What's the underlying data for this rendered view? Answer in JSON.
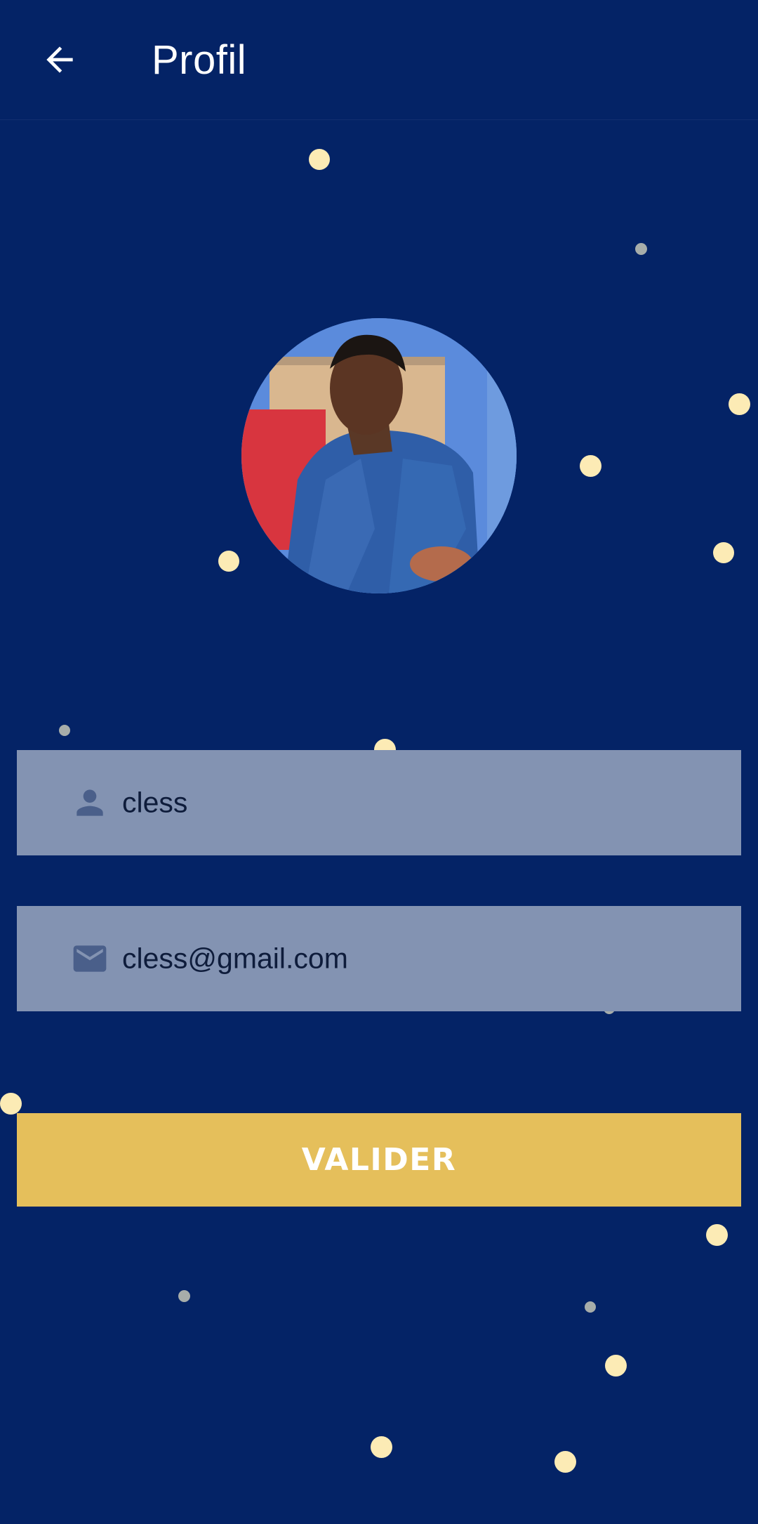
{
  "app_bar": {
    "title": "Profil",
    "back_icon": "arrow-left-icon"
  },
  "profile": {
    "avatar_description": "profile-photo"
  },
  "fields": {
    "username": {
      "icon": "person-icon",
      "value": "cless"
    },
    "email": {
      "icon": "envelope-icon",
      "value": "cless@gmail.com"
    }
  },
  "actions": {
    "submit_label": "VALIDER"
  },
  "colors": {
    "background": "#042366",
    "field_bg": "#8393b2",
    "button_bg": "#e5bf5b",
    "dot_light": "#fcebb5",
    "dot_grey": "#a7adaa"
  }
}
